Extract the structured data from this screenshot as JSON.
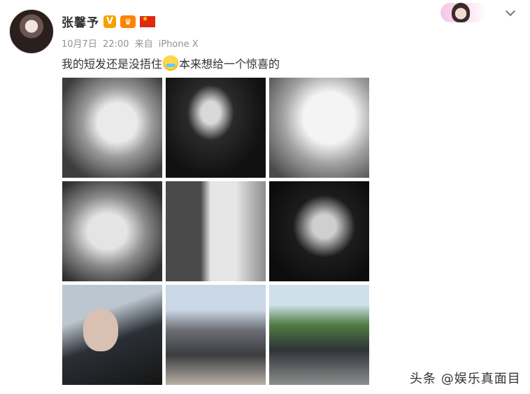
{
  "user": {
    "name": "张馨予",
    "verified_badge": "V"
  },
  "meta": {
    "date": "10月7日",
    "time": "22:00",
    "source_prefix": "来自",
    "device": "iPhone X"
  },
  "post": {
    "text_before_emoji": "我的短发还是没捂住",
    "emoji": "crying-laugh-emoji",
    "text_after_emoji": "本来想给一个惊喜的"
  },
  "photos": [
    {
      "icon": "bw-portrait-profile"
    },
    {
      "icon": "bw-portrait-suit"
    },
    {
      "icon": "bw-portrait-upward"
    },
    {
      "icon": "bw-portrait-hand-on-head"
    },
    {
      "icon": "bw-portrait-white-tee"
    },
    {
      "icon": "bw-portrait-dark"
    },
    {
      "icon": "color-selfie"
    },
    {
      "icon": "street-photo"
    },
    {
      "icon": "outdoor-fountain-photo"
    }
  ],
  "watermark": "头条 @娱乐真面目",
  "colors": {
    "name": "#333333",
    "meta": "#939393",
    "verified": "#f7a000"
  }
}
